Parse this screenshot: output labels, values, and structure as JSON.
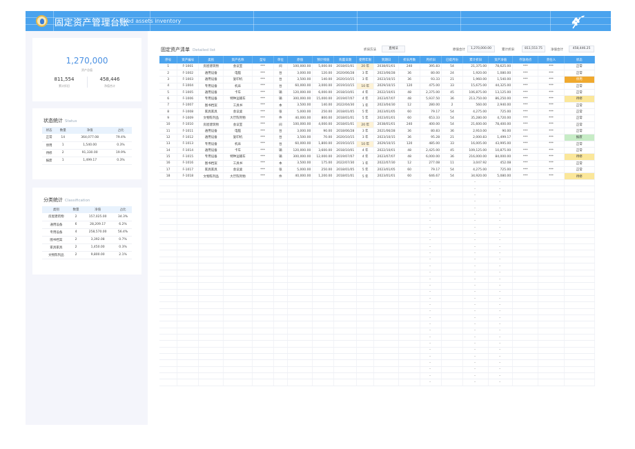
{
  "header": {
    "title": "固定资产管理台账",
    "subtitle": "Fixed assets inventory"
  },
  "summary": {
    "total_value": "1,270,000",
    "total_caption": "资产总值",
    "depr_value": "811,554",
    "depr_caption": "累计折旧",
    "net_value": "458,446",
    "net_caption": "净值合计"
  },
  "status_stats": {
    "title": "状态统计",
    "subtitle": "Status",
    "columns": [
      "状态",
      "数量",
      "净值",
      "占比"
    ],
    "rows": [
      [
        "正常",
        "14",
        "364,077.08",
        "79.4%"
      ],
      [
        "停用",
        "1",
        "1,540.00",
        "0.3%"
      ],
      [
        "待修",
        "2",
        "91,330.00",
        "19.9%"
      ],
      [
        "报废",
        "1",
        "1,499.17",
        "0.3%"
      ]
    ]
  },
  "class_stats": {
    "title": "分类统计",
    "subtitle": "Classification",
    "columns": [
      "类别",
      "数量",
      "净值",
      "占比"
    ],
    "rows": [
      [
        "房屋建筑物",
        "2",
        "157,025.00",
        "34.3%"
      ],
      [
        "通用设备",
        "6",
        "28,209.17",
        "6.2%"
      ],
      [
        "专用设备",
        "4",
        "258,570.00",
        "56.4%"
      ],
      [
        "图书档案",
        "2",
        "3,392.08",
        "0.7%"
      ],
      [
        "家具家具",
        "2",
        "1,450.00",
        "0.3%"
      ],
      [
        "文物陈列品",
        "2",
        "9,800.00",
        "2.1%"
      ]
    ]
  },
  "list": {
    "title": "固定资产清单",
    "subtitle": "Detailed list",
    "method_label": "折旧方法",
    "method_value": "直线法",
    "orig_label": "原值合计",
    "orig_value": "1,270,000.00",
    "depr_label": "累计折旧",
    "depr_value": "811,553.75",
    "net_label": "净值合计",
    "net_value": "458,446.25",
    "columns": [
      "序号",
      "资产编号",
      "类别",
      "资产名称",
      "型号",
      "单位",
      "原值",
      "预计残值",
      "购置日期",
      "使用年限",
      "到期日",
      "折旧月数",
      "月折旧",
      "已提月份",
      "累计折旧",
      "资产净值",
      "存放地点",
      "责任人",
      "状态"
    ],
    "rows": [
      [
        "1",
        "F-1001",
        "房屋建筑物",
        "会议室",
        "***",
        "间",
        "100,000.00",
        "5,000.00",
        "2018/01/01",
        "20 年",
        "2038/01/01",
        "240",
        "395.83",
        "54",
        "21,375.00",
        "78,625.00",
        "***",
        "***",
        "正常"
      ],
      [
        "2",
        "F-1002",
        "通用设备",
        "电脑",
        "***",
        "台",
        "3,000.00",
        "120.00",
        "2020/06/28",
        "3 年",
        "2023/06/28",
        "36",
        "80.00",
        "24",
        "1,920.00",
        "1,080.00",
        "***",
        "***",
        "正常"
      ],
      [
        "3",
        "F-1003",
        "通用设备",
        "复印机",
        "***",
        "台",
        "3,500.00",
        "140.00",
        "2020/10/15",
        "3 年",
        "2023/10/15",
        "36",
        "93.33",
        "21",
        "1,960.00",
        "1,540.00",
        "***",
        "***",
        "停用"
      ],
      [
        "4",
        "F-1004",
        "专用设备",
        "机床",
        "***",
        "台",
        "60,000.00",
        "3,000.00",
        "2019/10/15",
        "10 年",
        "2029/10/15",
        "120",
        "475.00",
        "33",
        "15,675.00",
        "44,325.00",
        "***",
        "***",
        "正常"
      ],
      [
        "5",
        "F-1005",
        "通用设备",
        "卡车",
        "***",
        "辆",
        "120,000.00",
        "6,000.00",
        "2018/10/01",
        "4 年",
        "2022/10/01",
        "48",
        "2,375.00",
        "45",
        "106,875.00",
        "13,125.00",
        "***",
        "***",
        "正常"
      ],
      [
        "6",
        "F-1006",
        "专用设备",
        "特种运输车",
        "***",
        "辆",
        "300,000.00",
        "15,000.00",
        "2019/07/07",
        "4 年",
        "2023/07/07",
        "48",
        "5,937.50",
        "36",
        "213,750.00",
        "86,250.00",
        "***",
        "***",
        "待修"
      ],
      [
        "7",
        "F-1007",
        "图书档案",
        "工具书",
        "***",
        "本",
        "3,500.00",
        "140.00",
        "2022/04/30",
        "1 年",
        "2023/04/30",
        "12",
        "280.00",
        "2",
        "560.00",
        "2,940.00",
        "***",
        "***",
        "正常"
      ],
      [
        "8",
        "F-1008",
        "家具家具",
        "会议桌",
        "***",
        "张",
        "5,000.00",
        "250.00",
        "2018/01/05",
        "5 年",
        "2023/01/05",
        "60",
        "79.17",
        "54",
        "4,275.00",
        "725.00",
        "***",
        "***",
        "正常"
      ],
      [
        "9",
        "F-1009",
        "文物陈列品",
        "大厅陈列物",
        "***",
        "件",
        "40,000.00",
        "800.00",
        "2018/01/01",
        "5 年",
        "2023/01/01",
        "60",
        "653.33",
        "54",
        "35,280.00",
        "4,720.00",
        "***",
        "***",
        "正常"
      ],
      [
        "10",
        "F-1010",
        "房屋建筑物",
        "会议室",
        "***",
        "间",
        "100,000.00",
        "4,000.00",
        "2018/01/01",
        "20 年",
        "2038/01/01",
        "240",
        "400.00",
        "54",
        "21,600.00",
        "78,400.00",
        "***",
        "***",
        "正常"
      ],
      [
        "11",
        "F-1011",
        "通用设备",
        "电脑",
        "***",
        "台",
        "3,000.00",
        "90.00",
        "2018/06/28",
        "3 年",
        "2021/06/28",
        "36",
        "80.83",
        "36",
        "2,910.00",
        "90.00",
        "***",
        "***",
        "正常"
      ],
      [
        "12",
        "F-1012",
        "通用设备",
        "复印机",
        "***",
        "台",
        "3,500.00",
        "70.00",
        "2020/10/15",
        "3 年",
        "2023/10/15",
        "36",
        "95.28",
        "21",
        "2,000.83",
        "1,499.17",
        "***",
        "***",
        "报废"
      ],
      [
        "13",
        "F-1013",
        "专用设备",
        "机床",
        "***",
        "台",
        "60,000.00",
        "1,800.00",
        "2019/10/15",
        "10 年",
        "2029/10/15",
        "120",
        "485.00",
        "33",
        "16,005.00",
        "43,995.00",
        "***",
        "***",
        "正常"
      ],
      [
        "14",
        "F-1014",
        "通用设备",
        "卡车",
        "***",
        "辆",
        "120,000.00",
        "3,600.00",
        "2018/10/01",
        "4 年",
        "2022/10/01",
        "48",
        "2,425.00",
        "45",
        "109,125.00",
        "10,875.00",
        "***",
        "***",
        "正常"
      ],
      [
        "15",
        "F-1015",
        "专用设备",
        "特种运输车",
        "***",
        "辆",
        "300,000.00",
        "12,000.00",
        "2019/07/07",
        "4 年",
        "2023/07/07",
        "48",
        "6,000.00",
        "36",
        "216,000.00",
        "84,000.00",
        "***",
        "***",
        "待修"
      ],
      [
        "16",
        "F-1016",
        "图书档案",
        "工具书",
        "***",
        "本",
        "3,500.00",
        "175.00",
        "2022/07/30",
        "1 年",
        "2022/07/30",
        "12",
        "277.08",
        "11",
        "3,047.92",
        "452.08",
        "***",
        "***",
        "正常"
      ],
      [
        "17",
        "F-1017",
        "家具家具",
        "会议桌",
        "***",
        "张",
        "5,000.00",
        "250.00",
        "2018/01/05",
        "5 年",
        "2023/01/05",
        "60",
        "79.17",
        "54",
        "4,275.00",
        "725.00",
        "***",
        "***",
        "正常"
      ],
      [
        "18",
        "F-1018",
        "文物陈列品",
        "大厅陈列物",
        "***",
        "件",
        "40,000.00",
        "1,200.00",
        "2018/01/01",
        "5 年",
        "2023/01/01",
        "60",
        "646.67",
        "54",
        "34,920.00",
        "5,080.00",
        "***",
        "***",
        "待修"
      ]
    ],
    "empty_placeholder": "-"
  }
}
